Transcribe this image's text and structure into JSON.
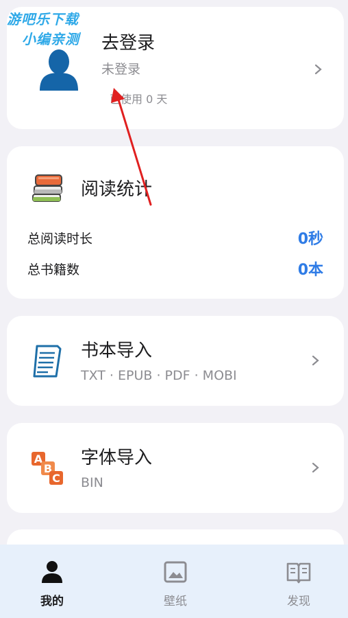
{
  "watermark": {
    "line1": "游吧乐下载",
    "line2": "小编亲测"
  },
  "login_card": {
    "title": "去登录",
    "status": "未登录",
    "days_used": "已使用 0 天",
    "avatar_icon": "person-silhouette-icon"
  },
  "stats_card": {
    "title": "阅读统计",
    "icon": "stacked-books-icon",
    "rows": [
      {
        "label": "总阅读时长",
        "value": "0秒"
      },
      {
        "label": "总书籍数",
        "value": "0本"
      }
    ],
    "value_color": "#2f7ce6"
  },
  "book_import": {
    "title": "书本导入",
    "formats": "TXT · EPUB · PDF · MOBI",
    "icon": "document-icon"
  },
  "font_import": {
    "title": "字体导入",
    "formats": "BIN",
    "icon": "abc-blocks-icon"
  },
  "tabbar": {
    "tabs": [
      {
        "label": "我的",
        "icon": "person-icon",
        "active": true
      },
      {
        "label": "壁纸",
        "icon": "image-icon",
        "active": false
      },
      {
        "label": "发现",
        "icon": "open-book-icon",
        "active": false
      }
    ]
  },
  "colors": {
    "background": "#f2f1f6",
    "accent_blue": "#2f7ce6",
    "avatar_blue": "#1565a8",
    "tabbar_bg": "#e7f0fb",
    "annotation_arrow": "#e02020"
  }
}
